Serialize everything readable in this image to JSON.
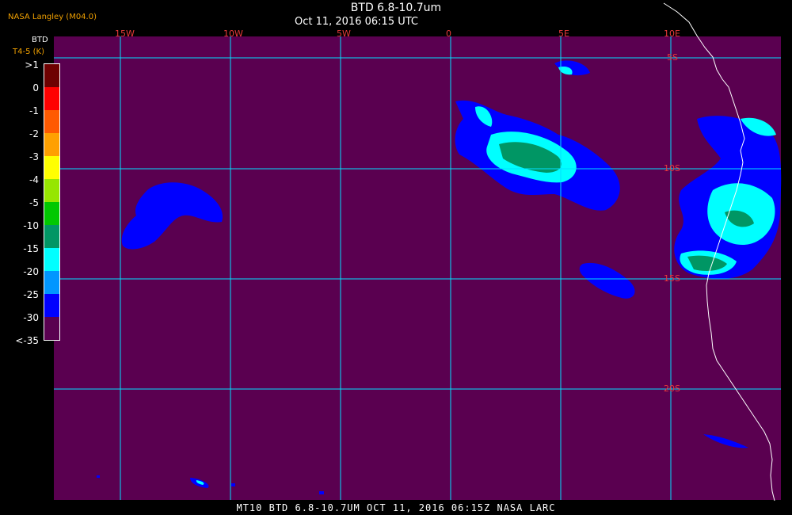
{
  "header": {
    "title": "BTD 6.8-10.7um",
    "date": "Oct 11, 2016 06:15 UTC",
    "org": "NASA Langley (M04.0)"
  },
  "legend": {
    "title": "BTD",
    "subtitle": "T4-5 (K)",
    "labels": [
      ">1",
      "0",
      "-1",
      "-2",
      "-3",
      "-4",
      "-5",
      "-10",
      "-15",
      "-20",
      "-25",
      "-30",
      "<-35"
    ],
    "colors": [
      "#6e0000",
      "#ff0000",
      "#ff5a00",
      "#ffa000",
      "#ffff00",
      "#96e600",
      "#00c800",
      "#009664",
      "#00ffff",
      "#0096ff",
      "#0000ff",
      "#5a0050"
    ]
  },
  "grid": {
    "lon_labels": [
      "15W",
      "10W",
      "5W",
      "0",
      "5E",
      "10E"
    ],
    "lat_labels": [
      "5S",
      "10S",
      "15S",
      "20S"
    ]
  },
  "footer": "MT10  BTD 6.8-10.7UM   OCT 11, 2016 06:15Z  NASA LARC",
  "colors": {
    "background": "#5a0050",
    "grid": "#00e0ff",
    "coast": "#ffffff",
    "grid_label": "#e83a3a"
  }
}
